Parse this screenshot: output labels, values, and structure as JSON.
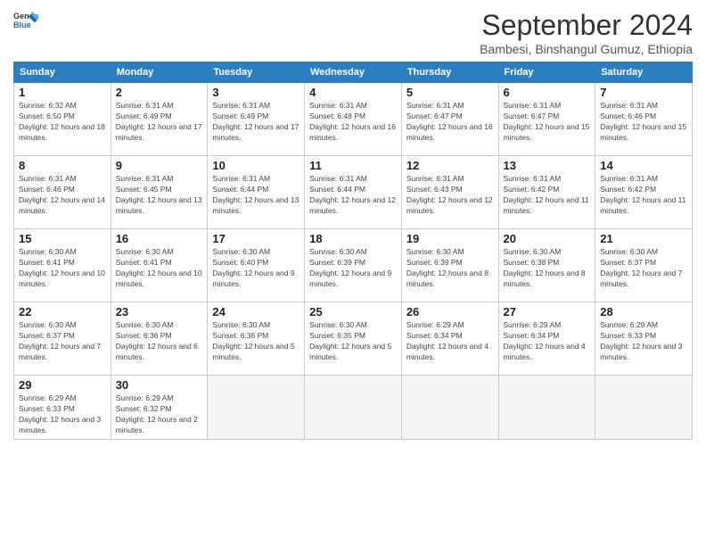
{
  "logo": {
    "line1": "General",
    "line2": "Blue",
    "icon_color": "#1a6faf"
  },
  "title": "September 2024",
  "subtitle": "Bambesi, Binshangul Gumuz, Ethiopia",
  "headers": [
    "Sunday",
    "Monday",
    "Tuesday",
    "Wednesday",
    "Thursday",
    "Friday",
    "Saturday"
  ],
  "weeks": [
    [
      {
        "day": "1",
        "sunrise": "6:32 AM",
        "sunset": "6:50 PM",
        "daylight": "12 hours and 18 minutes."
      },
      {
        "day": "2",
        "sunrise": "6:31 AM",
        "sunset": "6:49 PM",
        "daylight": "12 hours and 17 minutes."
      },
      {
        "day": "3",
        "sunrise": "6:31 AM",
        "sunset": "6:49 PM",
        "daylight": "12 hours and 17 minutes."
      },
      {
        "day": "4",
        "sunrise": "6:31 AM",
        "sunset": "6:48 PM",
        "daylight": "12 hours and 16 minutes."
      },
      {
        "day": "5",
        "sunrise": "6:31 AM",
        "sunset": "6:47 PM",
        "daylight": "12 hours and 16 minutes."
      },
      {
        "day": "6",
        "sunrise": "6:31 AM",
        "sunset": "6:47 PM",
        "daylight": "12 hours and 15 minutes."
      },
      {
        "day": "7",
        "sunrise": "6:31 AM",
        "sunset": "6:46 PM",
        "daylight": "12 hours and 15 minutes."
      }
    ],
    [
      {
        "day": "8",
        "sunrise": "6:31 AM",
        "sunset": "6:46 PM",
        "daylight": "12 hours and 14 minutes."
      },
      {
        "day": "9",
        "sunrise": "6:31 AM",
        "sunset": "6:45 PM",
        "daylight": "12 hours and 13 minutes."
      },
      {
        "day": "10",
        "sunrise": "6:31 AM",
        "sunset": "6:44 PM",
        "daylight": "12 hours and 13 minutes."
      },
      {
        "day": "11",
        "sunrise": "6:31 AM",
        "sunset": "6:44 PM",
        "daylight": "12 hours and 12 minutes."
      },
      {
        "day": "12",
        "sunrise": "6:31 AM",
        "sunset": "6:43 PM",
        "daylight": "12 hours and 12 minutes."
      },
      {
        "day": "13",
        "sunrise": "6:31 AM",
        "sunset": "6:42 PM",
        "daylight": "12 hours and 11 minutes."
      },
      {
        "day": "14",
        "sunrise": "6:31 AM",
        "sunset": "6:42 PM",
        "daylight": "12 hours and 11 minutes."
      }
    ],
    [
      {
        "day": "15",
        "sunrise": "6:30 AM",
        "sunset": "6:41 PM",
        "daylight": "12 hours and 10 minutes."
      },
      {
        "day": "16",
        "sunrise": "6:30 AM",
        "sunset": "6:41 PM",
        "daylight": "12 hours and 10 minutes."
      },
      {
        "day": "17",
        "sunrise": "6:30 AM",
        "sunset": "6:40 PM",
        "daylight": "12 hours and 9 minutes."
      },
      {
        "day": "18",
        "sunrise": "6:30 AM",
        "sunset": "6:39 PM",
        "daylight": "12 hours and 9 minutes."
      },
      {
        "day": "19",
        "sunrise": "6:30 AM",
        "sunset": "6:39 PM",
        "daylight": "12 hours and 8 minutes."
      },
      {
        "day": "20",
        "sunrise": "6:30 AM",
        "sunset": "6:38 PM",
        "daylight": "12 hours and 8 minutes."
      },
      {
        "day": "21",
        "sunrise": "6:30 AM",
        "sunset": "6:37 PM",
        "daylight": "12 hours and 7 minutes."
      }
    ],
    [
      {
        "day": "22",
        "sunrise": "6:30 AM",
        "sunset": "6:37 PM",
        "daylight": "12 hours and 7 minutes."
      },
      {
        "day": "23",
        "sunrise": "6:30 AM",
        "sunset": "6:36 PM",
        "daylight": "12 hours and 6 minutes."
      },
      {
        "day": "24",
        "sunrise": "6:30 AM",
        "sunset": "6:36 PM",
        "daylight": "12 hours and 5 minutes."
      },
      {
        "day": "25",
        "sunrise": "6:30 AM",
        "sunset": "6:35 PM",
        "daylight": "12 hours and 5 minutes."
      },
      {
        "day": "26",
        "sunrise": "6:29 AM",
        "sunset": "6:34 PM",
        "daylight": "12 hours and 4 minutes."
      },
      {
        "day": "27",
        "sunrise": "6:29 AM",
        "sunset": "6:34 PM",
        "daylight": "12 hours and 4 minutes."
      },
      {
        "day": "28",
        "sunrise": "6:29 AM",
        "sunset": "6:33 PM",
        "daylight": "12 hours and 3 minutes."
      }
    ],
    [
      {
        "day": "29",
        "sunrise": "6:29 AM",
        "sunset": "6:33 PM",
        "daylight": "12 hours and 3 minutes."
      },
      {
        "day": "30",
        "sunrise": "6:29 AM",
        "sunset": "6:32 PM",
        "daylight": "12 hours and 2 minutes."
      },
      {
        "day": "",
        "sunrise": "",
        "sunset": "",
        "daylight": ""
      },
      {
        "day": "",
        "sunrise": "",
        "sunset": "",
        "daylight": ""
      },
      {
        "day": "",
        "sunrise": "",
        "sunset": "",
        "daylight": ""
      },
      {
        "day": "",
        "sunrise": "",
        "sunset": "",
        "daylight": ""
      },
      {
        "day": "",
        "sunrise": "",
        "sunset": "",
        "daylight": ""
      }
    ]
  ]
}
